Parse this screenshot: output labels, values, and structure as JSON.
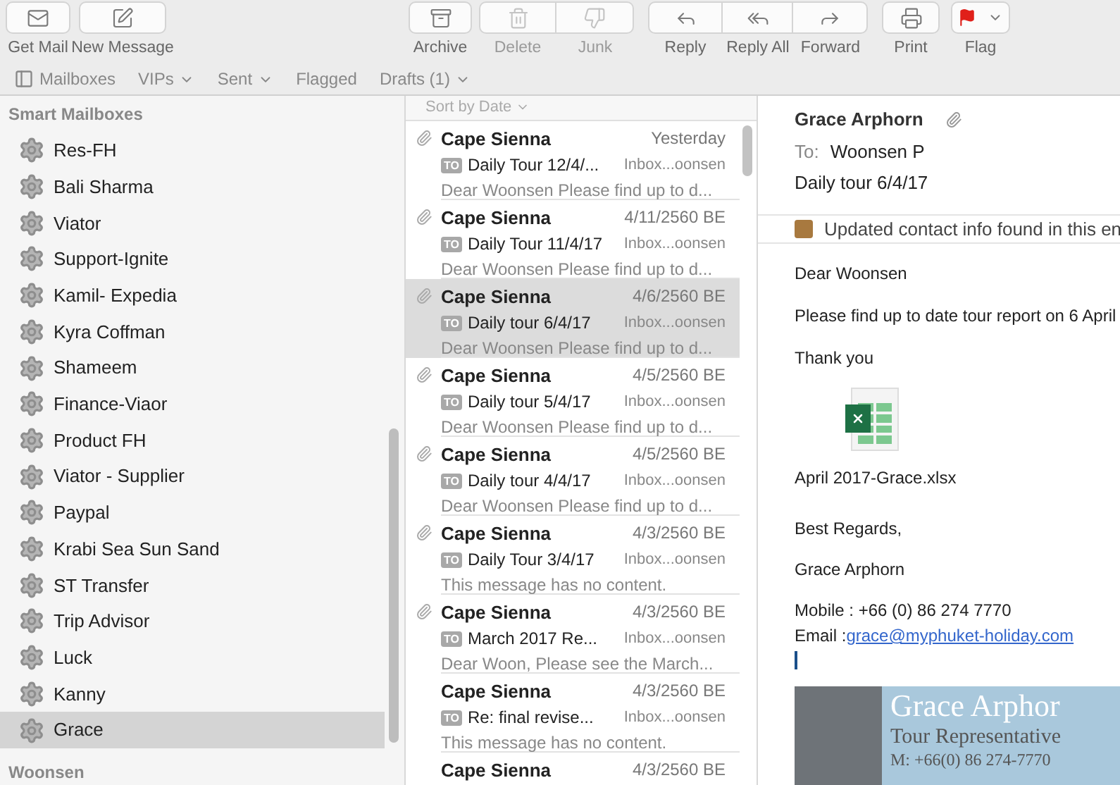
{
  "toolbar": {
    "buttons": [
      {
        "kind": "get-mail",
        "label": "Get Mail",
        "disabled": false
      },
      {
        "kind": "new-message",
        "label": "New Message",
        "disabled": false
      },
      {
        "kind": "archive",
        "label": "Archive",
        "disabled": false
      },
      {
        "kind": "delete",
        "label": "Delete",
        "disabled": true
      },
      {
        "kind": "junk",
        "label": "Junk",
        "disabled": true
      },
      {
        "kind": "reply",
        "label": "Reply",
        "disabled": false
      },
      {
        "kind": "reply-all",
        "label": "Reply All",
        "disabled": false
      },
      {
        "kind": "forward",
        "label": "Forward",
        "disabled": false
      },
      {
        "kind": "print",
        "label": "Print",
        "disabled": false
      },
      {
        "kind": "flag",
        "label": "Flag",
        "disabled": false
      }
    ]
  },
  "favorites_bar": [
    {
      "label": "Mailboxes",
      "kind": "sidebar-toggle"
    },
    {
      "label": "VIPs",
      "kind": "menu"
    },
    {
      "label": "Sent",
      "kind": "menu"
    },
    {
      "label": "Flagged",
      "kind": "plain"
    },
    {
      "label": "Drafts (1)",
      "kind": "menu"
    }
  ],
  "sidebar": {
    "section": "Smart Mailboxes",
    "items": [
      {
        "label": "Res-FH",
        "selected": false
      },
      {
        "label": "Bali Sharma",
        "selected": false
      },
      {
        "label": "Viator",
        "selected": false
      },
      {
        "label": "Support-Ignite",
        "selected": false
      },
      {
        "label": "Kamil- Expedia",
        "selected": false
      },
      {
        "label": "Kyra Coffman",
        "selected": false
      },
      {
        "label": "Shameem",
        "selected": false
      },
      {
        "label": "Finance-Viaor",
        "selected": false
      },
      {
        "label": "Product FH",
        "selected": false
      },
      {
        "label": "Viator - Supplier",
        "selected": false
      },
      {
        "label": "Paypal",
        "selected": false
      },
      {
        "label": "Krabi Sea Sun Sand",
        "selected": false
      },
      {
        "label": "ST Transfer",
        "selected": false
      },
      {
        "label": "Trip Advisor",
        "selected": false
      },
      {
        "label": "Luck",
        "selected": false
      },
      {
        "label": "Kanny",
        "selected": false
      },
      {
        "label": "Grace",
        "selected": true
      }
    ],
    "next_section": "Woonsen"
  },
  "message_list": {
    "sort": "Sort by Date",
    "messages": [
      {
        "sender": "Cape Sienna",
        "date": "Yesterday",
        "badge": "TO",
        "subject": "Daily Tour 12/4/...",
        "mailbox": "Inbox...oonsen",
        "preview": "Dear Woonsen Please find up to d...",
        "attachment": true,
        "selected": false
      },
      {
        "sender": "Cape Sienna",
        "date": "4/11/2560 BE",
        "badge": "TO",
        "subject": "Daily Tour 11/4/17",
        "mailbox": "Inbox...oonsen",
        "preview": "Dear Woonsen Please find up to d...",
        "attachment": true,
        "selected": false
      },
      {
        "sender": "Cape Sienna",
        "date": "4/6/2560 BE",
        "badge": "TO",
        "subject": "Daily tour 6/4/17",
        "mailbox": "Inbox...oonsen",
        "preview": "Dear Woonsen Please find up to d...",
        "attachment": true,
        "selected": true
      },
      {
        "sender": "Cape Sienna",
        "date": "4/5/2560 BE",
        "badge": "TO",
        "subject": "Daily tour 5/4/17",
        "mailbox": "Inbox...oonsen",
        "preview": "Dear Woonsen Please find up to d...",
        "attachment": true,
        "selected": false
      },
      {
        "sender": "Cape Sienna",
        "date": "4/5/2560 BE",
        "badge": "TO",
        "subject": "Daily tour 4/4/17",
        "mailbox": "Inbox...oonsen",
        "preview": "Dear Woonsen Please find up to d...",
        "attachment": true,
        "selected": false
      },
      {
        "sender": "Cape Sienna",
        "date": "4/3/2560 BE",
        "badge": "TO",
        "subject": "Daily Tour 3/4/17",
        "mailbox": "Inbox...oonsen",
        "preview": "This message has no content.",
        "attachment": true,
        "selected": false
      },
      {
        "sender": "Cape Sienna",
        "date": "4/3/2560 BE",
        "badge": "TO",
        "subject": "March 2017 Re...",
        "mailbox": "Inbox...oonsen",
        "preview": "Dear Woon, Please see the March...",
        "attachment": true,
        "selected": false
      },
      {
        "sender": "Cape Sienna",
        "date": "4/3/2560 BE",
        "badge": "TO",
        "subject": "Re: final revise...",
        "mailbox": "Inbox...oonsen",
        "preview": "This message has no content.",
        "attachment": false,
        "selected": false
      },
      {
        "sender": "Cape Sienna",
        "date": "4/3/2560 BE",
        "attachment": false,
        "selected": false
      }
    ]
  },
  "message": {
    "from": "Grace Arphorn",
    "attachment": true,
    "to_label": "To:",
    "to": "Woonsen P",
    "subject": "Daily tour 6/4/17",
    "notice": "Updated contact info found in this en",
    "body_top": [
      "Dear Woonsen",
      "Please find up to date tour report on 6 April",
      "Thank you"
    ],
    "attachment_name": "April 2017-Grace.xlsx",
    "body_bottom": [
      "Best Regards,",
      "Grace Arphorn"
    ],
    "mobile": "Mobile : +66 (0) 86 274 7770",
    "email_label": "Email : ",
    "email": "grace@myphuket-holiday.com",
    "banner": {
      "name": "Grace Arphor",
      "title": "Tour Representative",
      "phone": "M: +66(0) 86 274-7770"
    }
  }
}
